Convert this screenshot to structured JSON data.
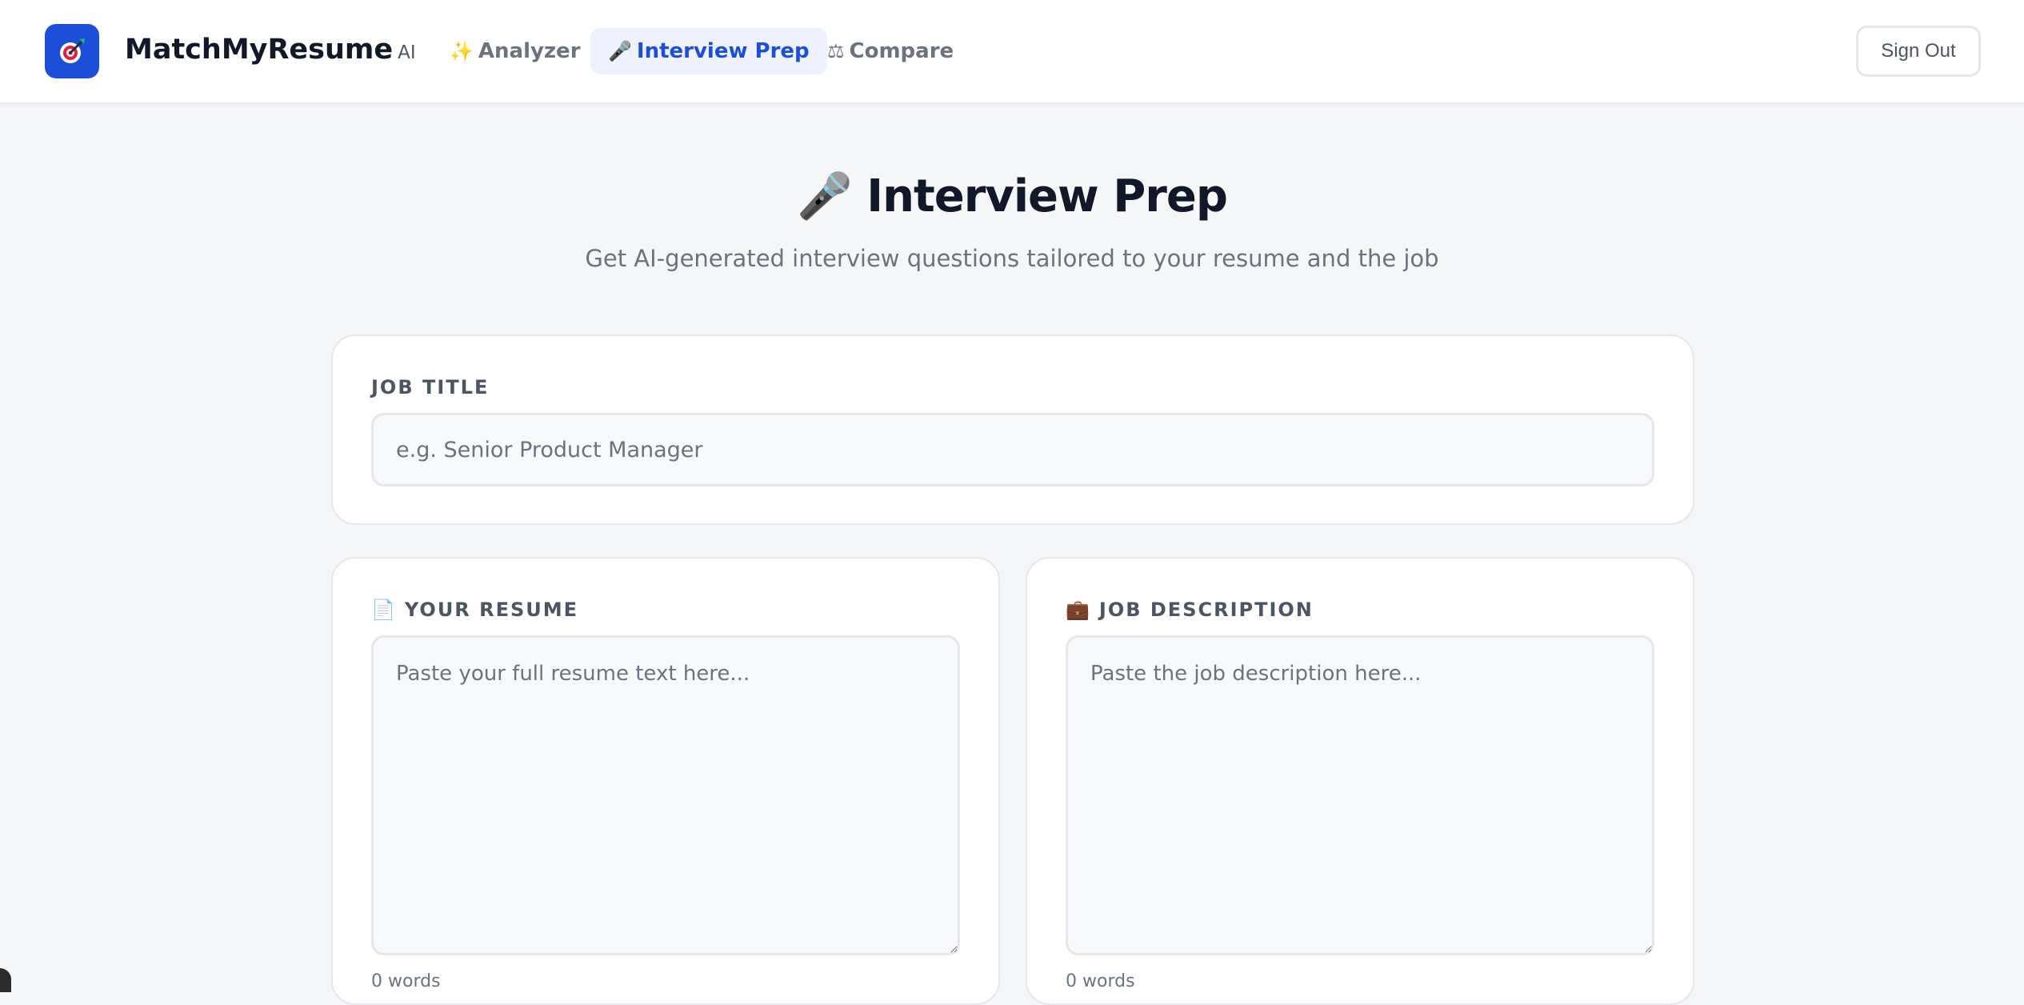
{
  "header": {
    "brand_name": "MatchMyResume",
    "brand_suffix": "AI",
    "logo_icon": "target-dart-icon",
    "nav": [
      {
        "icon": "✨",
        "label": "Analyzer",
        "active": false
      },
      {
        "icon": "🎤",
        "label": "Interview Prep",
        "active": true
      },
      {
        "icon": "⚖",
        "label": "Compare",
        "active": false
      }
    ],
    "sign_out_label": "Sign Out"
  },
  "hero": {
    "icon": "🎤",
    "title": "Interview Prep",
    "subtitle": "Get AI-generated interview questions tailored to your resume and the job"
  },
  "form": {
    "job_title": {
      "label": "JOB TITLE",
      "value": "",
      "placeholder": "e.g. Senior Product Manager"
    },
    "resume": {
      "icon": "📄",
      "label": "YOUR RESUME",
      "value": "",
      "placeholder": "Paste your full resume text here...",
      "word_count": "0 words"
    },
    "job_description": {
      "icon": "💼",
      "label": "JOB DESCRIPTION",
      "value": "",
      "placeholder": "Paste the job description here...",
      "word_count": "0 words"
    }
  },
  "colors": {
    "accent": "#1d4ed8",
    "active_nav_bg": "#eef2fe",
    "page_bg": "#f5f6f8",
    "muted_text": "#6b7280"
  }
}
